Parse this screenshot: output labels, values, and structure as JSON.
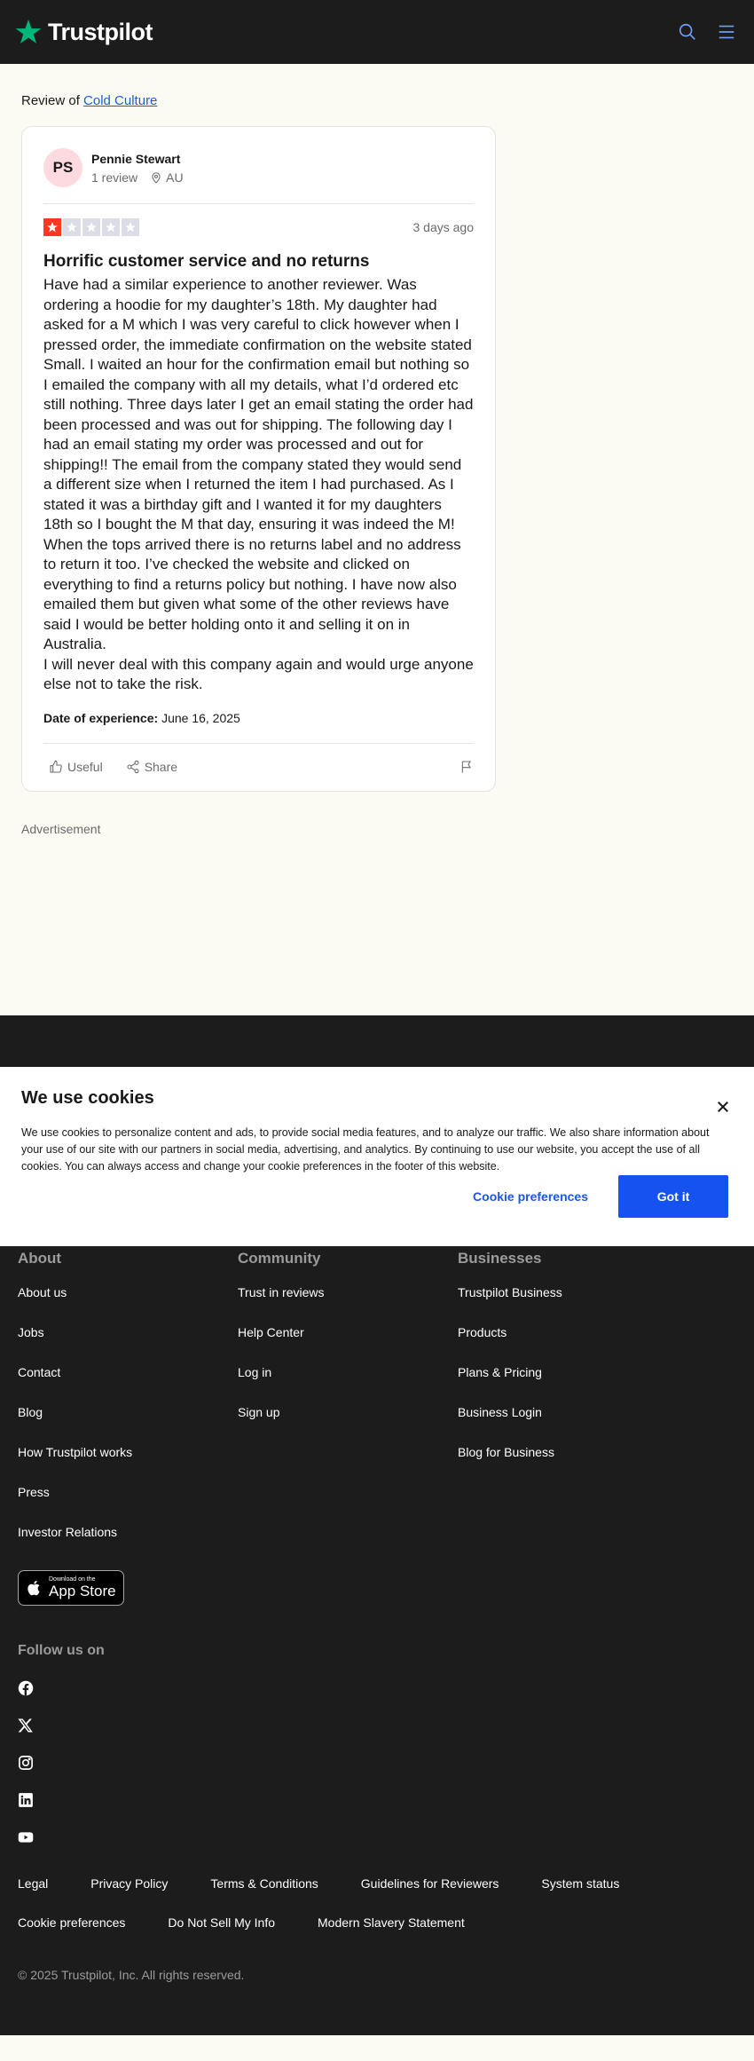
{
  "header": {
    "brand": "Trustpilot",
    "colors": {
      "background": "#1c1c1c",
      "star": "#00b67a"
    },
    "icons": [
      "trustpilot-star-icon",
      "search-icon",
      "menu-icon"
    ]
  },
  "review_of": {
    "prefix": "Review of",
    "company": "Cold Culture"
  },
  "review": {
    "reviewer": {
      "initials": "PS",
      "name": "Pennie Stewart",
      "review_count": "1 review",
      "country": "AU"
    },
    "rating": 1,
    "rating_max": 5,
    "rating_color": "#ff3722",
    "date_ago": "3 days ago",
    "title": "Horrific customer service and no returns",
    "body": [
      "Have had a similar experience to another reviewer. Was ordering a hoodie for my daughter’s 18th. My daughter had asked for a M which I was very careful to click however when I pressed order, the immediate confirmation on the website stated Small. I waited an hour for the confirmation email but nothing so I emailed the company with all my details, what I’d ordered etc still nothing. Three days later I get an email stating the order had been processed and was out for shipping. The following day I had an email stating my order was processed and out for shipping!! The email from the company stated they would send a different size when I returned the item I had purchased. As I stated it was a birthday gift and I wanted it for my daughters 18th so I bought the M that day, ensuring it was indeed the M!",
      "When the tops arrived there is no returns label and no address to return it too. I’ve checked the website and clicked on everything to find a returns policy but nothing. I have now also emailed them but given what some of the other reviews have said I would be better holding onto it and selling it on in Australia.",
      "I will never deal with this company again and would urge anyone else not to take the risk."
    ],
    "date_of_experience_label": "Date of experience:",
    "date_of_experience": "June 16, 2025",
    "actions": {
      "useful": "Useful",
      "share": "Share"
    }
  },
  "advertisement_label": "Advertisement",
  "cookie_banner": {
    "title": "We use cookies",
    "text": "We use cookies to personalize content and ads, to provide social media features, and to analyze our traffic. We also share information about your use of our site with our partners in social media, advertising, and analytics. By continuing to use our website, you accept the use of all cookies. You can always access and change your cookie preferences in the footer of this website.",
    "preferences_label": "Cookie preferences",
    "accept_label": "Got it",
    "accent_color": "#1652f0"
  },
  "footer": {
    "columns": [
      {
        "title": "About",
        "links": [
          "About us",
          "Jobs",
          "Contact",
          "Blog",
          "How Trustpilot works",
          "Press",
          "Investor Relations"
        ]
      },
      {
        "title": "Community",
        "links": [
          "Trust in reviews",
          "Help Center",
          "Log in",
          "Sign up"
        ]
      },
      {
        "title": "Businesses",
        "links": [
          "Trustpilot Business",
          "Products",
          "Plans & Pricing",
          "Business Login",
          "Blog for Business"
        ]
      }
    ],
    "app_store": {
      "small": "Download on the",
      "big": "App Store"
    },
    "follow_title": "Follow us on",
    "socials": [
      "facebook-icon",
      "x-icon",
      "instagram-icon",
      "linkedin-icon",
      "youtube-icon"
    ],
    "legal_links": [
      "Legal",
      "Privacy Policy",
      "Terms & Conditions",
      "Guidelines for Reviewers",
      "System status",
      "Cookie preferences",
      "Do Not Sell My Info",
      "Modern Slavery Statement"
    ],
    "copyright": "© 2025 Trustpilot, Inc. All rights reserved."
  }
}
